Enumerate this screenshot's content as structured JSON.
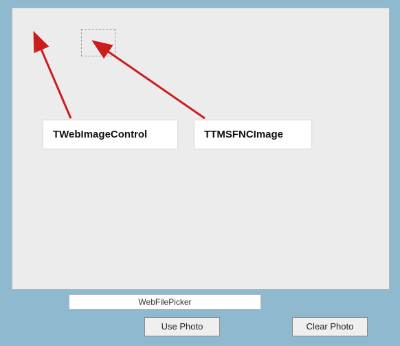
{
  "annotations": {
    "image_control_label": "TWebImageControl",
    "fnc_image_label": "TTMSFNCImage"
  },
  "file_picker": {
    "label": "WebFilePicker"
  },
  "buttons": {
    "use_photo": "Use Photo",
    "clear_photo": "Clear Photo"
  },
  "colors": {
    "page_bg": "#8fb9ce",
    "panel_bg": "#ececec",
    "panel_border": "#b7b7b7",
    "arrow": "#cc1c1c"
  }
}
